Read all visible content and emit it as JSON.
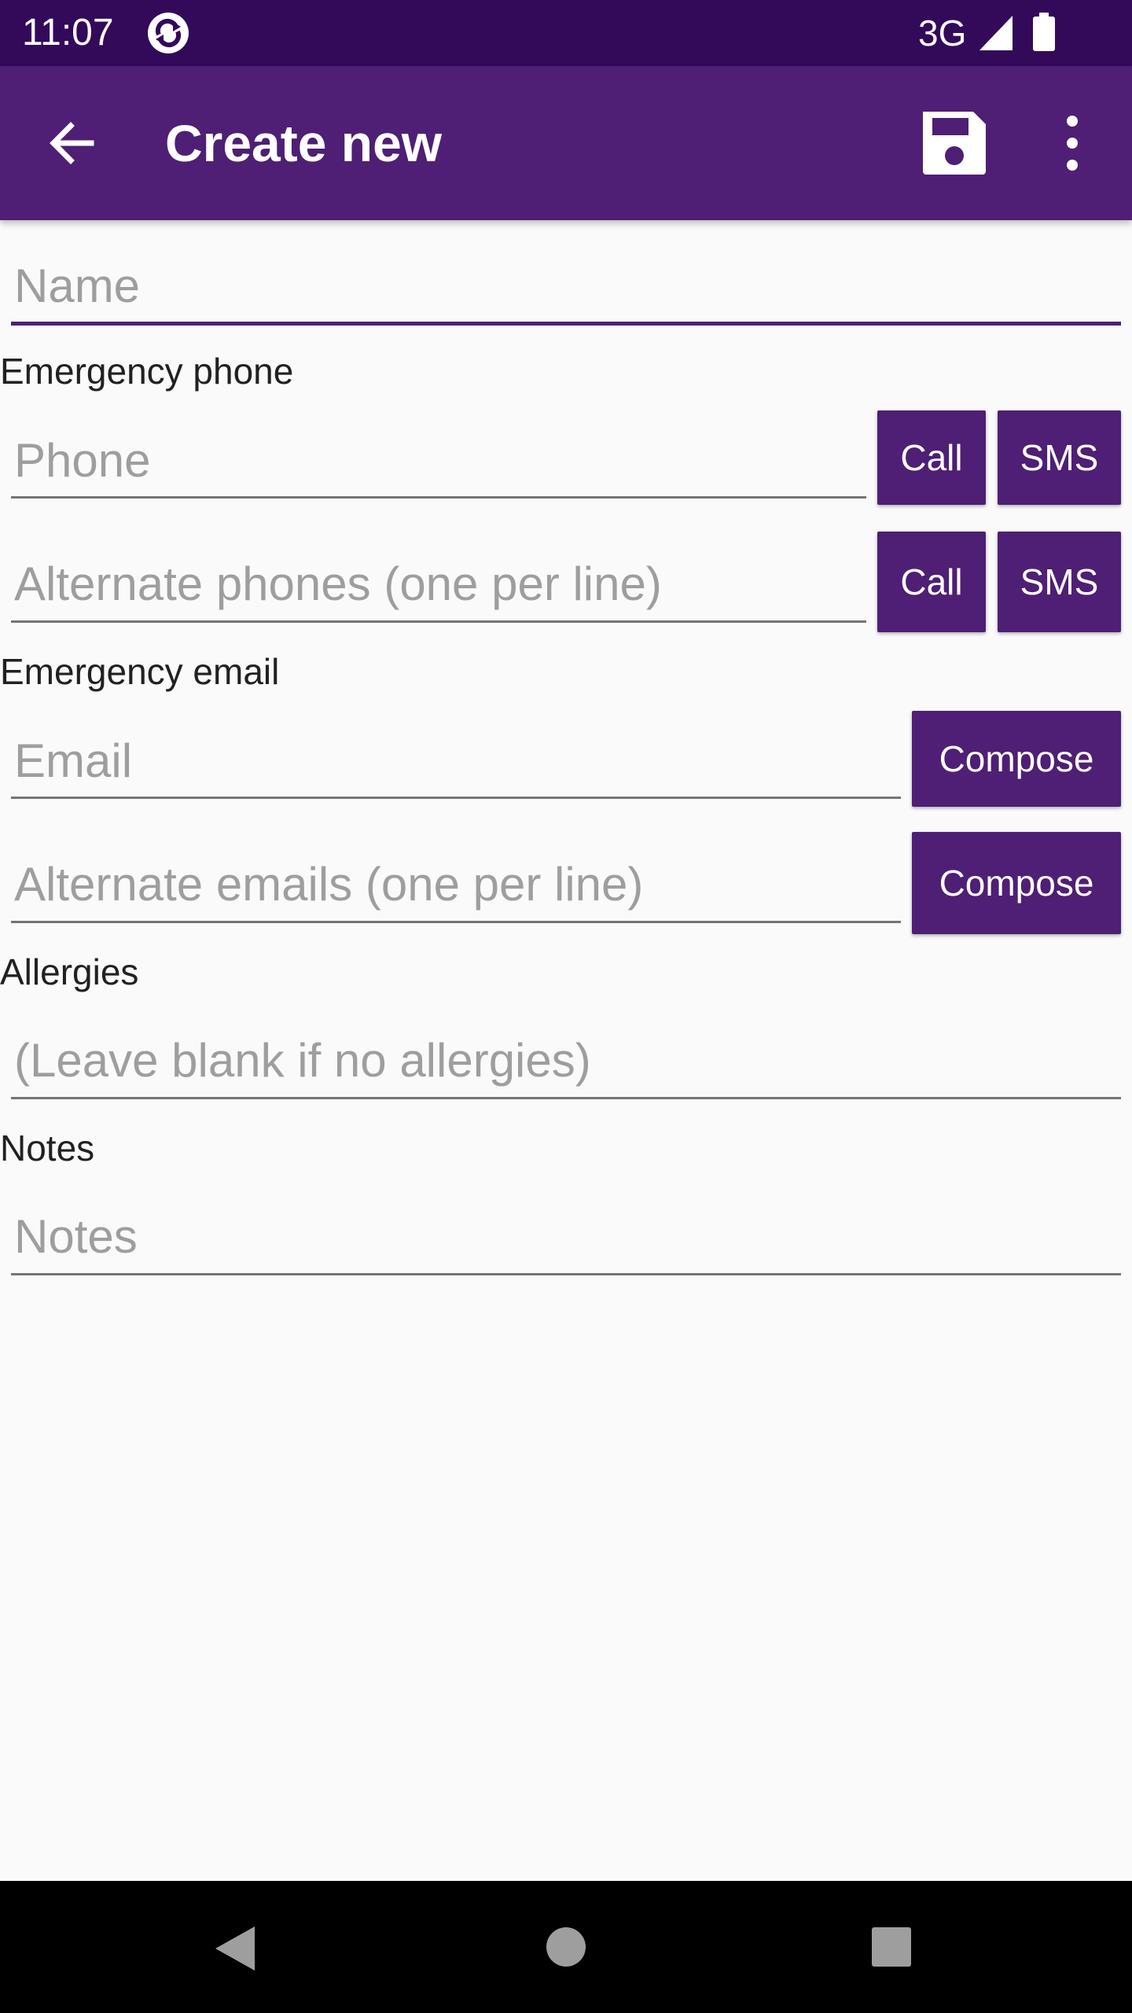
{
  "status_bar": {
    "time": "11:07",
    "network": "3G",
    "app_icon": "sync-circle-icon",
    "signal_icon": "signal-icon",
    "battery_icon": "battery-icon"
  },
  "app_bar": {
    "title": "Create new",
    "back_icon": "arrow-back-icon",
    "save_icon": "floppy-save-icon",
    "menu_icon": "more-vert-icon"
  },
  "form": {
    "name": {
      "placeholder": "Name",
      "value": ""
    },
    "emergency_phone": {
      "label": "Emergency phone",
      "phone": {
        "placeholder": "Phone",
        "value": ""
      },
      "alternate": {
        "placeholder": "Alternate phones (one per line)",
        "value": ""
      },
      "call_label": "Call",
      "sms_label": "SMS"
    },
    "emergency_email": {
      "label": "Emergency email",
      "email": {
        "placeholder": "Email",
        "value": ""
      },
      "alternate": {
        "placeholder": "Alternate emails (one per line)",
        "value": ""
      },
      "compose_label": "Compose"
    },
    "allergies": {
      "label": "Allergies",
      "field": {
        "placeholder": "(Leave blank if no allergies)",
        "value": ""
      }
    },
    "notes": {
      "label": "Notes",
      "field": {
        "placeholder": "Notes",
        "value": ""
      }
    }
  },
  "nav_bar": {
    "back_icon": "nav-back-triangle-icon",
    "home_icon": "nav-home-circle-icon",
    "recents_icon": "nav-recents-square-icon"
  },
  "colors": {
    "status_bar": "#33095a",
    "app_bar": "#4e1f74",
    "accent": "#4e1f74",
    "background": "#fafafa"
  }
}
